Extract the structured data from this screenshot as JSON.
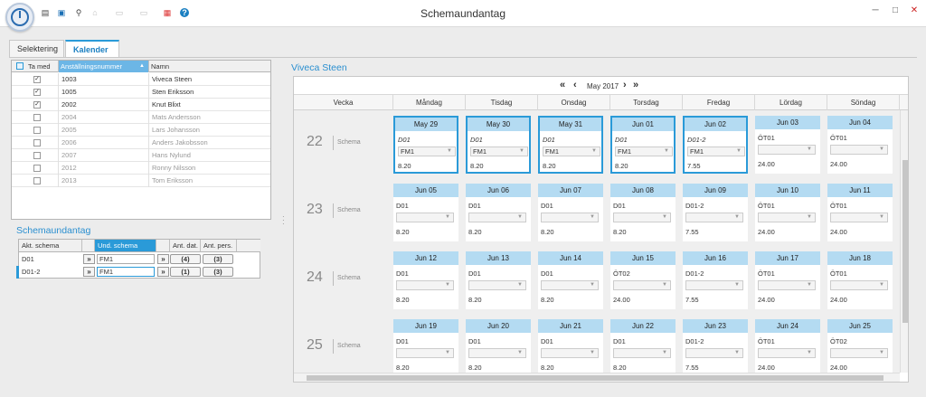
{
  "window": {
    "title": "Schemaundantag"
  },
  "toolbar": {
    "icons": [
      "list-icon",
      "save-icon",
      "search-icon",
      "home-icon",
      "doc-icon",
      "doc2-icon",
      "grid-color-icon",
      "help-icon"
    ]
  },
  "tabs": [
    {
      "label": "Selektering"
    },
    {
      "label": "Kalender"
    }
  ],
  "employees": {
    "headers": {
      "include": "Ta med",
      "number": "Anställningsnummer",
      "name": "Namn"
    },
    "rows": [
      {
        "checked": true,
        "number": "1003",
        "name": "Viveca Steen",
        "dim": false
      },
      {
        "checked": true,
        "number": "1005",
        "name": "Sten Eriksson",
        "dim": false
      },
      {
        "checked": true,
        "number": "2002",
        "name": "Knut Blixt",
        "dim": false
      },
      {
        "checked": false,
        "number": "2004",
        "name": "Mats Andersson",
        "dim": true
      },
      {
        "checked": false,
        "number": "2005",
        "name": "Lars Johansson",
        "dim": true
      },
      {
        "checked": false,
        "number": "2006",
        "name": "Anders Jakobsson",
        "dim": true
      },
      {
        "checked": false,
        "number": "2007",
        "name": "Hans Nylund",
        "dim": true
      },
      {
        "checked": false,
        "number": "2012",
        "name": "Ronny Nilsson",
        "dim": true
      },
      {
        "checked": false,
        "number": "2013",
        "name": "Tom Eriksson",
        "dim": true
      }
    ]
  },
  "exceptions": {
    "title": "Schemaundantag",
    "headers": {
      "current": "Akt. schema",
      "exception": "Und. schema",
      "dates": "Ant. dat.",
      "persons": "Ant. pers."
    },
    "rows": [
      {
        "current": "D01",
        "exception": "FM1",
        "dates": "(4)",
        "persons": "(3)"
      },
      {
        "current": "D01-2",
        "exception": "FM1",
        "dates": "(1)",
        "persons": "(3)"
      }
    ]
  },
  "calendar": {
    "person": "Viveca Steen",
    "period": "May 2017",
    "headers": [
      "Vecka",
      "Måndag",
      "Tisdag",
      "Onsdag",
      "Torsdag",
      "Fredag",
      "Lördag",
      "Söndag"
    ],
    "schema_label": "Schema",
    "weeks": [
      {
        "num": "22",
        "days": [
          {
            "date": "May 29",
            "sched": "D01",
            "sel": "FM1",
            "hours": "8.20",
            "hl": true
          },
          {
            "date": "May 30",
            "sched": "D01",
            "sel": "FM1",
            "hours": "8.20",
            "hl": true
          },
          {
            "date": "May 31",
            "sched": "D01",
            "sel": "FM1",
            "hours": "8.20",
            "hl": true
          },
          {
            "date": "Jun 01",
            "sched": "D01",
            "sel": "FM1",
            "hours": "8.20",
            "hl": true
          },
          {
            "date": "Jun 02",
            "sched": "D01-2",
            "sel": "FM1",
            "hours": "7.55",
            "hl": true
          },
          {
            "date": "Jun 03",
            "sched": "ÖT01",
            "sel": "",
            "hours": "24.00",
            "hl": false
          },
          {
            "date": "Jun 04",
            "sched": "ÖT01",
            "sel": "",
            "hours": "24.00",
            "hl": false
          }
        ]
      },
      {
        "num": "23",
        "days": [
          {
            "date": "Jun 05",
            "sched": "D01",
            "sel": "",
            "hours": "8.20",
            "hl": false
          },
          {
            "date": "Jun 06",
            "sched": "D01",
            "sel": "",
            "hours": "8.20",
            "hl": false
          },
          {
            "date": "Jun 07",
            "sched": "D01",
            "sel": "",
            "hours": "8.20",
            "hl": false
          },
          {
            "date": "Jun 08",
            "sched": "D01",
            "sel": "",
            "hours": "8.20",
            "hl": false
          },
          {
            "date": "Jun 09",
            "sched": "D01-2",
            "sel": "",
            "hours": "7.55",
            "hl": false
          },
          {
            "date": "Jun 10",
            "sched": "ÖT01",
            "sel": "",
            "hours": "24.00",
            "hl": false
          },
          {
            "date": "Jun 11",
            "sched": "ÖT01",
            "sel": "",
            "hours": "24.00",
            "hl": false
          }
        ]
      },
      {
        "num": "24",
        "days": [
          {
            "date": "Jun 12",
            "sched": "D01",
            "sel": "",
            "hours": "8.20",
            "hl": false
          },
          {
            "date": "Jun 13",
            "sched": "D01",
            "sel": "",
            "hours": "8.20",
            "hl": false
          },
          {
            "date": "Jun 14",
            "sched": "D01",
            "sel": "",
            "hours": "8.20",
            "hl": false
          },
          {
            "date": "Jun 15",
            "sched": "ÖT02",
            "sel": "",
            "hours": "24.00",
            "hl": false
          },
          {
            "date": "Jun 16",
            "sched": "D01-2",
            "sel": "",
            "hours": "7.55",
            "hl": false
          },
          {
            "date": "Jun 17",
            "sched": "ÖT01",
            "sel": "",
            "hours": "24.00",
            "hl": false
          },
          {
            "date": "Jun 18",
            "sched": "ÖT01",
            "sel": "",
            "hours": "24.00",
            "hl": false
          }
        ]
      },
      {
        "num": "25",
        "days": [
          {
            "date": "Jun 19",
            "sched": "D01",
            "sel": "",
            "hours": "8.20",
            "hl": false
          },
          {
            "date": "Jun 20",
            "sched": "D01",
            "sel": "",
            "hours": "8.20",
            "hl": false
          },
          {
            "date": "Jun 21",
            "sched": "D01",
            "sel": "",
            "hours": "8.20",
            "hl": false
          },
          {
            "date": "Jun 22",
            "sched": "D01",
            "sel": "",
            "hours": "8.20",
            "hl": false
          },
          {
            "date": "Jun 23",
            "sched": "D01-2",
            "sel": "",
            "hours": "7.55",
            "hl": false
          },
          {
            "date": "Jun 24",
            "sched": "ÖT01",
            "sel": "",
            "hours": "24.00",
            "hl": false
          },
          {
            "date": "Jun 25",
            "sched": "ÖT02",
            "sel": "",
            "hours": "24.00",
            "hl": false
          }
        ]
      }
    ]
  },
  "colors": {
    "accent": "#2a9ad8",
    "dayhead": "#b4dbf2"
  }
}
